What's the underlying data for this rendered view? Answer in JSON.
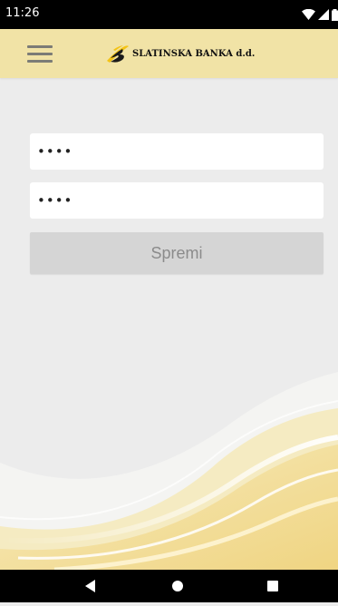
{
  "status_bar": {
    "time": "11:26",
    "icons": [
      "wifi-icon",
      "signal-icon",
      "battery-icon"
    ]
  },
  "header": {
    "menu_icon": "hamburger-menu-icon",
    "brand_name": "SLATINSKA BANKA d.d.",
    "brand_logo": "slatinska-banka-logo"
  },
  "form": {
    "username_value": "••••",
    "password_value": "••••",
    "save_label": "Spremi"
  },
  "nav_bar": {
    "icons": [
      "back-icon",
      "home-icon",
      "recent-apps-icon"
    ]
  },
  "colors": {
    "app_bar": "#f1e3a6",
    "background": "#ececec",
    "button_disabled": "#d5d5d5",
    "button_text": "#8b8b8b",
    "logo_accent": "#f3c315",
    "wave_gold": "#efd27b"
  }
}
